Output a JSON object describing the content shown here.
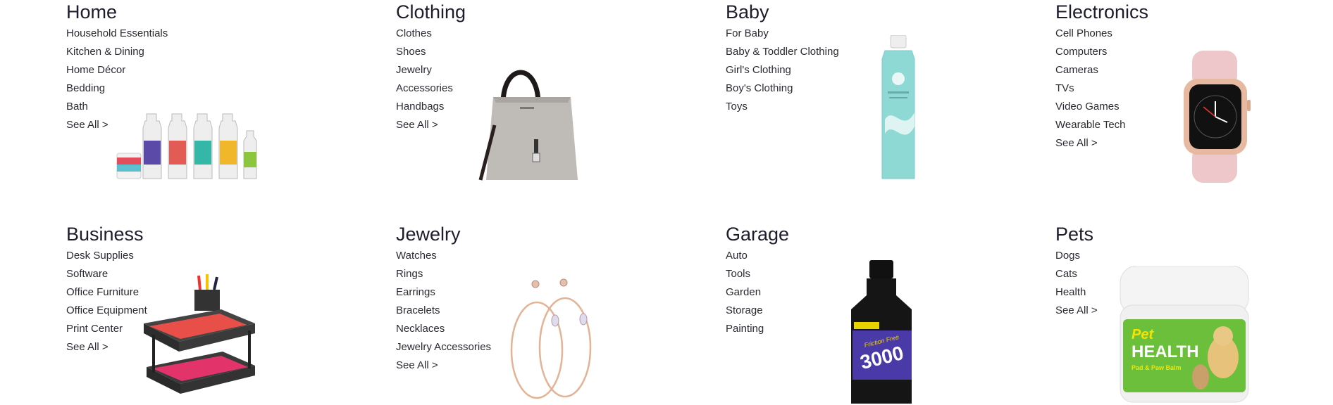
{
  "categories": {
    "home": {
      "title": "Home",
      "links": [
        "Household Essentials",
        "Kitchen & Dining",
        "Home Décor",
        "Bedding",
        "Bath"
      ],
      "see_all": "See All >",
      "image_icon": "cleaning-spray-bottles-icon"
    },
    "clothing": {
      "title": "Clothing",
      "links": [
        "Clothes",
        "Shoes",
        "Jewelry",
        "Accessories",
        "Handbags"
      ],
      "see_all": "See All >",
      "image_icon": "handbag-icon"
    },
    "baby": {
      "title": "Baby",
      "links": [
        "For Baby",
        "Baby & Toddler Clothing",
        "Girl's Clothing",
        "Boy's Clothing",
        "Toys"
      ],
      "image_icon": "lotion-bottle-icon"
    },
    "electronics": {
      "title": "Electronics",
      "links": [
        "Cell Phones",
        "Computers",
        "Cameras",
        "TVs",
        "Video Games",
        "Wearable Tech"
      ],
      "see_all": "See All >",
      "image_icon": "smartwatch-icon"
    },
    "business": {
      "title": "Business",
      "links": [
        "Desk Supplies",
        "Software",
        "Office Furniture",
        "Office Equipment",
        "Print Center"
      ],
      "see_all": "See All >",
      "image_icon": "desk-organizer-tray-icon"
    },
    "jewelry": {
      "title": "Jewelry",
      "links": [
        "Watches",
        "Rings",
        "Earrings",
        "Bracelets",
        "Necklaces",
        "Jewelry Accessories"
      ],
      "see_all": "See All >",
      "image_icon": "hoop-earrings-icon"
    },
    "garage": {
      "title": "Garage",
      "links": [
        "Auto",
        "Tools",
        "Garden",
        "Storage",
        "Painting"
      ],
      "image_icon": "fuel-additive-bottle-icon",
      "product_label": "3000",
      "product_brand": "Friction Free"
    },
    "pets": {
      "title": "Pets",
      "links": [
        "Dogs",
        "Cats",
        "Health"
      ],
      "see_all": "See All >",
      "image_icon": "pet-balm-jar-icon",
      "product_brand": "Pet",
      "product_name": "HEALTH",
      "product_sub": "Pad & Paw Balm"
    }
  }
}
